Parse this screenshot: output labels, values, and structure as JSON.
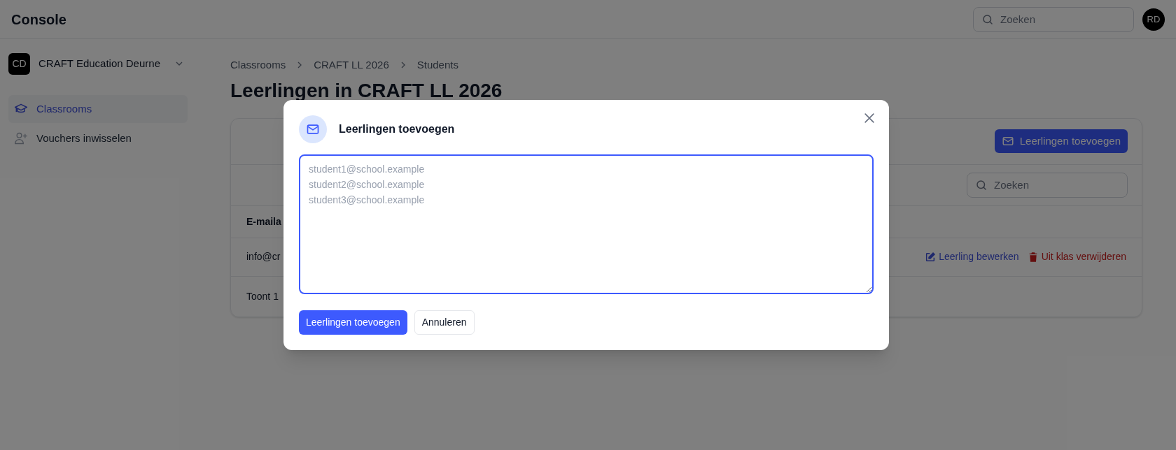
{
  "header": {
    "title": "Console",
    "search": {
      "placeholder": "Zoeken"
    },
    "avatar": "RD"
  },
  "sidebar": {
    "org": {
      "initials": "CD",
      "name": "CRAFT Education Deurne"
    },
    "items": [
      {
        "label": "Classrooms",
        "kind": "cap",
        "selected": true
      },
      {
        "label": "Vouchers inwisselen",
        "kind": "user-plus",
        "selected": false
      }
    ]
  },
  "breadcrumb": [
    "Classrooms",
    "CRAFT LL 2026",
    "Students"
  ],
  "page_title": "Leerlingen in CRAFT LL 2026",
  "card": {
    "add_button": "Leerlingen toevoegen",
    "search": {
      "placeholder": "Zoeken"
    },
    "column_header": "E-maila",
    "row": {
      "email": "info@cr",
      "edit": "Leerling bewerken",
      "remove": "Uit klas verwijderen"
    },
    "footer": "Toont 1"
  },
  "modal": {
    "title": "Leerlingen toevoegen",
    "textarea": {
      "placeholder": "student1@school.example\nstudent2@school.example\nstudent3@school.example",
      "focused": true
    },
    "buttons": [
      {
        "label": "Leerlingen toevoegen",
        "kind": "primary"
      },
      {
        "label": "Annuleren",
        "kind": "secondary"
      }
    ]
  }
}
